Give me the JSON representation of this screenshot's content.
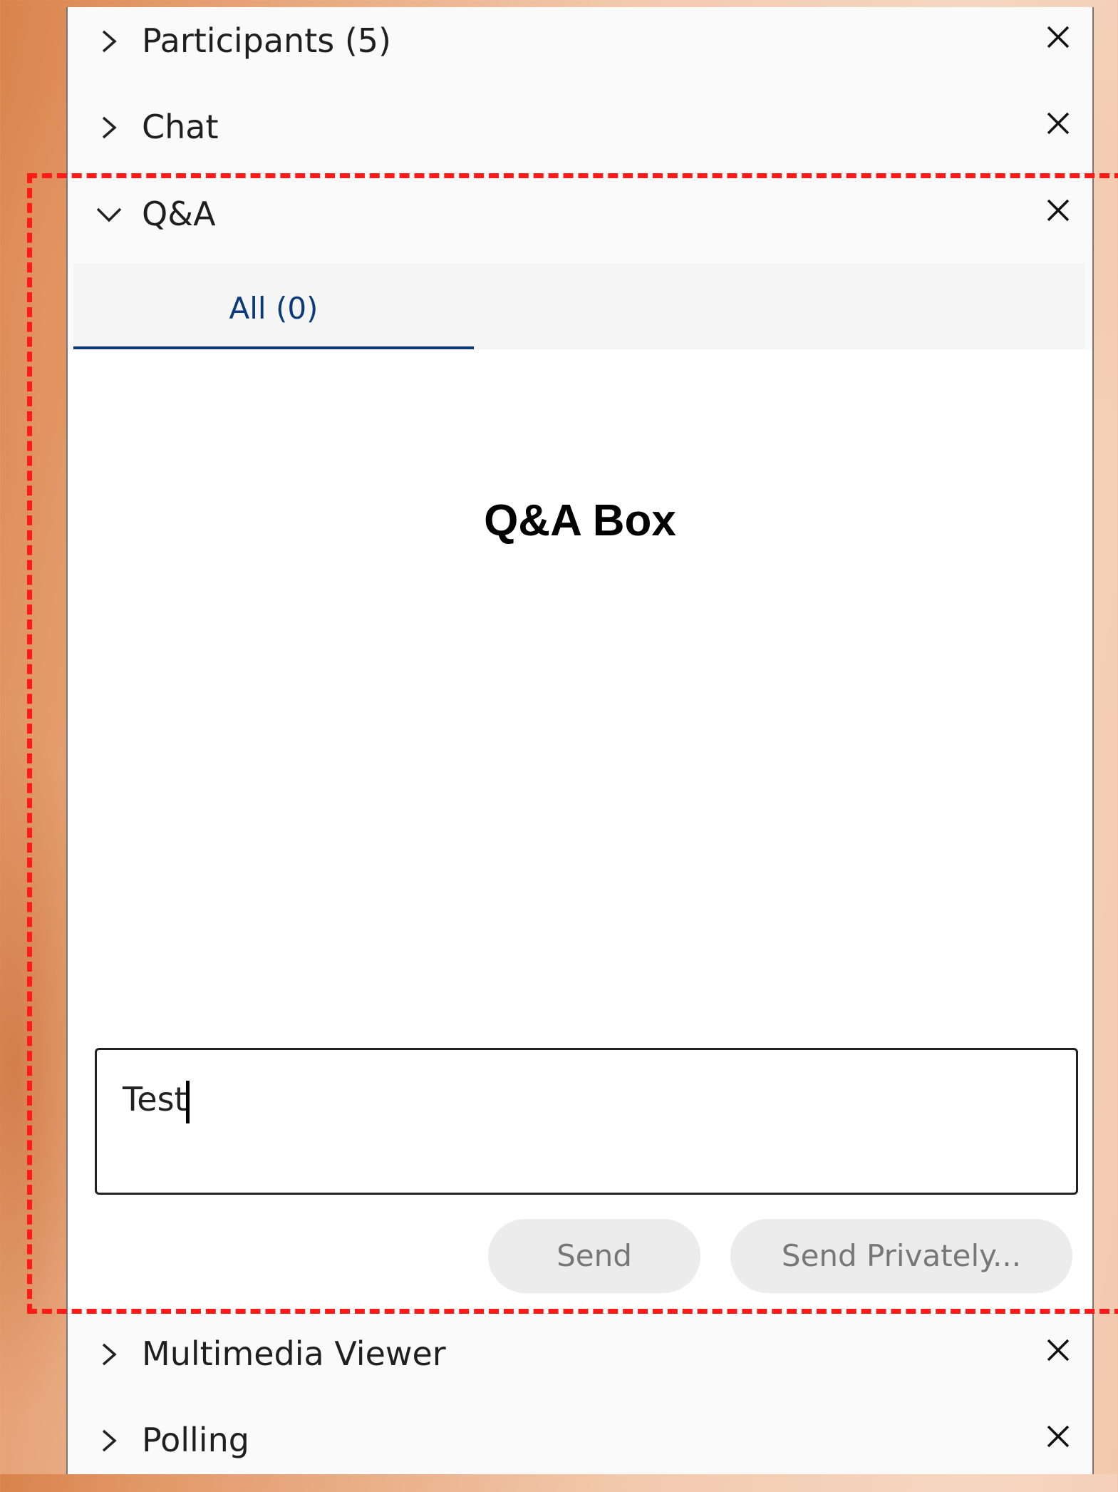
{
  "panels": {
    "participants_label": "Participants (5)",
    "chat_label": "Chat",
    "qa_label": "Q&A",
    "multimedia_label": "Multimedia Viewer",
    "polling_label": "Polling"
  },
  "qa": {
    "tab_all_label": "All (0)",
    "box_annotation": "Q&A Box",
    "input_value": "Test",
    "send_label": "Send",
    "send_privately_label": "Send Privately..."
  },
  "colors": {
    "accent": "#0b3a7a",
    "annotation": "#ff1a1a"
  },
  "icons": {
    "collapsed": "chevron-right-icon",
    "expanded": "chevron-down-icon",
    "close": "close-icon"
  }
}
